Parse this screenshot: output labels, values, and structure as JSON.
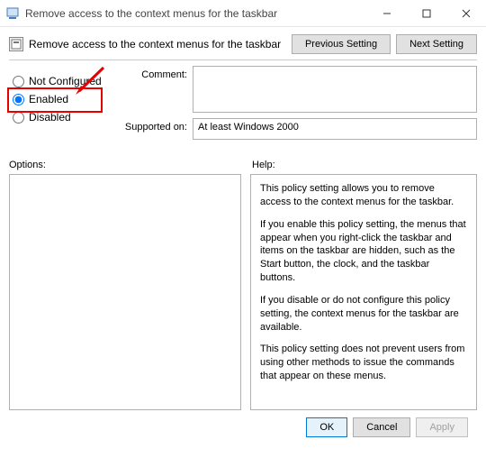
{
  "window": {
    "title": "Remove access to the context menus for the taskbar"
  },
  "header": {
    "policy_title": "Remove access to the context menus for the taskbar",
    "previous_btn": "Previous Setting",
    "next_btn": "Next Setting"
  },
  "radios": {
    "not_configured": "Not Configured",
    "enabled": "Enabled",
    "disabled": "Disabled",
    "selected": "enabled"
  },
  "fields": {
    "comment_label": "Comment:",
    "comment_value": "",
    "supported_label": "Supported on:",
    "supported_value": "At least Windows 2000"
  },
  "labels": {
    "options": "Options:",
    "help": "Help:"
  },
  "help": {
    "p1": "This policy setting allows you to remove access to the context menus for the taskbar.",
    "p2": "If you enable this policy setting, the menus that appear when you right-click the taskbar and items on the taskbar are hidden, such as the Start button, the clock, and the taskbar buttons.",
    "p3": "If you disable or do not configure this policy setting, the context menus for the taskbar are available.",
    "p4": "This policy setting does not prevent users from using other methods to issue the commands that appear on these menus."
  },
  "footer": {
    "ok": "OK",
    "cancel": "Cancel",
    "apply": "Apply"
  }
}
